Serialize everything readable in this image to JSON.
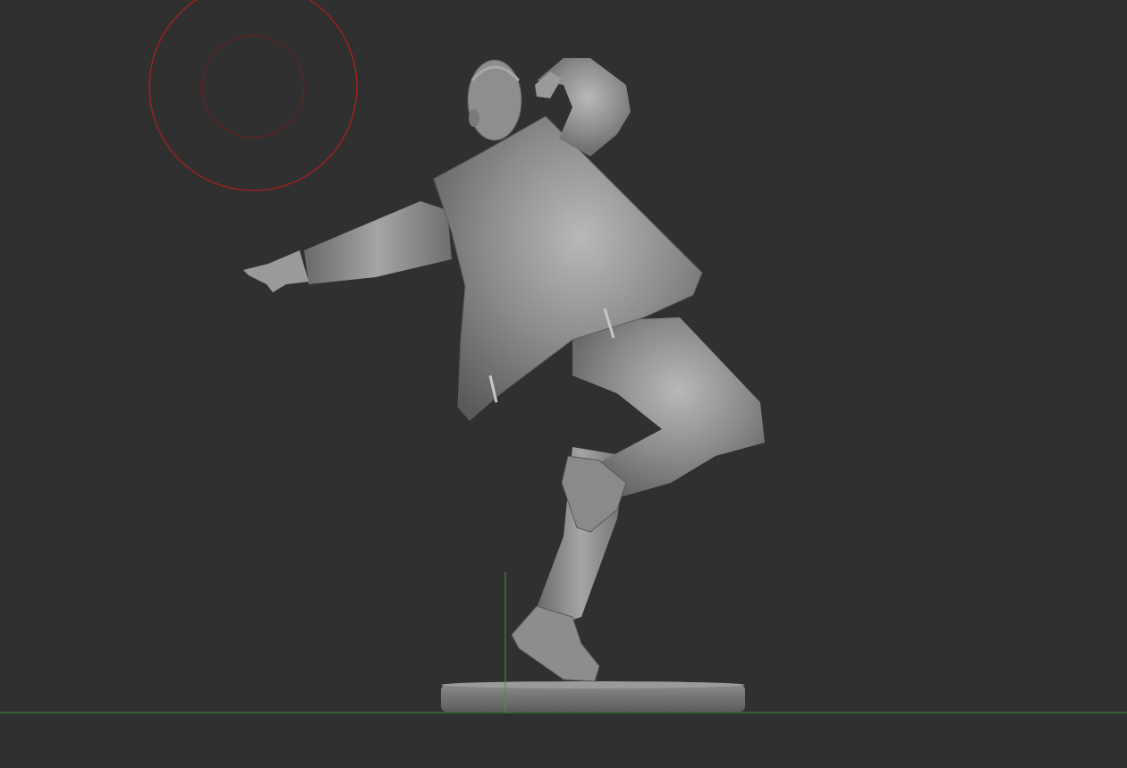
{
  "viewport": {
    "background_color": "#303030",
    "model_color": "#8a8a8a",
    "brush_cursor_color": "#b02020",
    "axis_color": "#3a9a3a",
    "brush_cursor_icon": "brush-radius-icon",
    "floor_icon": "floor-grid-axis-icon"
  }
}
